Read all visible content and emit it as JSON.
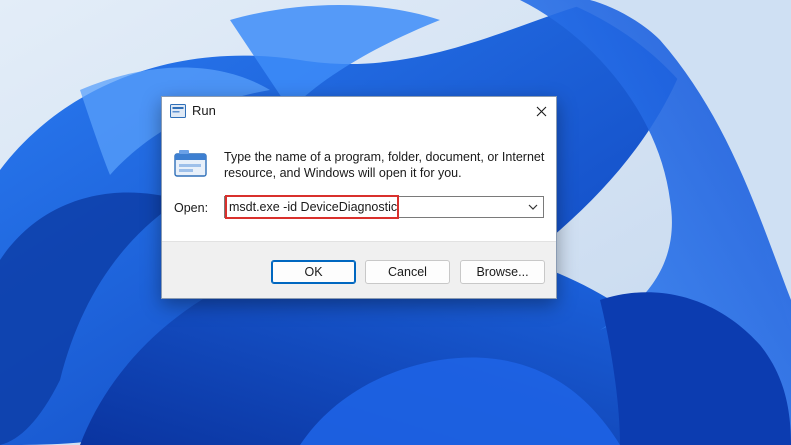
{
  "window": {
    "title": "Run",
    "icon": "run-icon",
    "close_icon": "close-icon"
  },
  "dialog": {
    "description": "Type the name of a program, folder, document, or Internet resource, and Windows will open it for you.",
    "open_label": "Open:",
    "open_value": "msdt.exe -id DeviceDiagnostic",
    "dropdown_icon": "chevron-down-icon"
  },
  "buttons": {
    "ok_label": "OK",
    "cancel_label": "Cancel",
    "browse_label": "Browse..."
  },
  "colors": {
    "accent": "#0067c0",
    "highlight": "#d9302c",
    "wallpaper_base": "#cfe0f3",
    "wallpaper_blue": "#1a5fe0"
  }
}
